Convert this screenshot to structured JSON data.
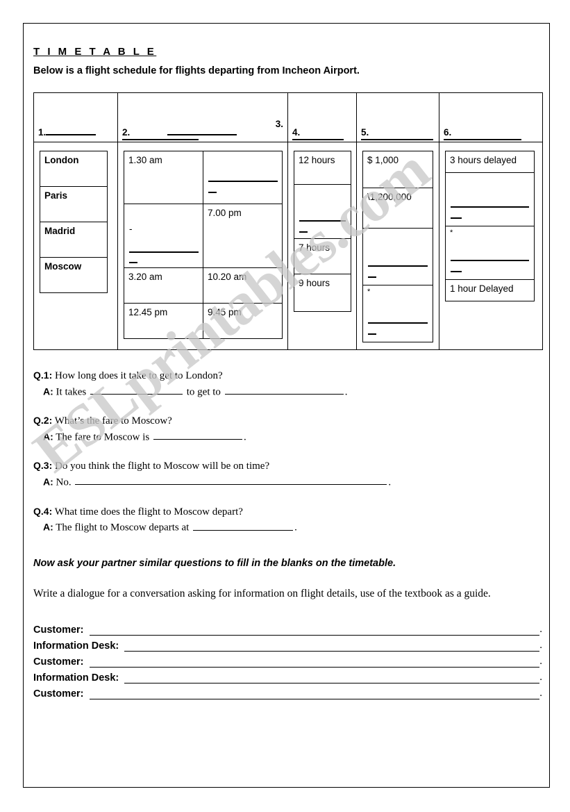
{
  "document": {
    "title": "T I M E T A B L E",
    "subtitle": "Below is a flight schedule for flights departing from Incheon Airport.",
    "watermark": "ESLprintables.com"
  },
  "timetable": {
    "headers": [
      {
        "num": "1.",
        "blank_after": true
      },
      {
        "num": "2.",
        "blank_after": true,
        "extra_num": "3."
      },
      {
        "num": "4.",
        "blank_after": true
      },
      {
        "num": "5.",
        "blank_after": true
      },
      {
        "num": "6.",
        "blank_after": true
      }
    ],
    "destinations": [
      "London",
      "Paris",
      "Madrid",
      "Moscow"
    ],
    "departures": [
      "1.30 am",
      "",
      "3.20 am",
      "12.45 pm"
    ],
    "arrivals": [
      "",
      "7.00 pm",
      "10.20 am",
      "9.45 pm"
    ],
    "durations": [
      "12 hours",
      "",
      "7 hours",
      "9 hours"
    ],
    "fares": [
      "$ 1,000",
      "\\1,200,000",
      "",
      ""
    ],
    "status": [
      "3 hours delayed",
      "",
      "",
      "1 hour Delayed"
    ]
  },
  "questions": [
    {
      "q_label": "Q.1:",
      "q_text": "How long does it take to get to London?",
      "a_label": "A:",
      "a_prefix": "It takes",
      "a_middle": "to get to",
      "a_suffix": "."
    },
    {
      "q_label": "Q.2:",
      "q_text": "What’s the fare to Moscow?",
      "a_label": "A:",
      "a_prefix": "The fare to Moscow is",
      "a_middle": "",
      "a_suffix": "."
    },
    {
      "q_label": "Q.3:",
      "q_text": "Do you think the flight to Moscow will be on time?",
      "a_label": "A:",
      "a_prefix": "No.",
      "a_middle": "",
      "a_suffix": "."
    },
    {
      "q_label": "Q.4:",
      "q_text": "What time does the flight to Moscow depart?",
      "a_label": "A:",
      "a_prefix": "The flight to Moscow departs at",
      "a_middle": "",
      "a_suffix": "."
    }
  ],
  "instructions": {
    "partner_task": "Now ask your partner similar questions to fill in the blanks on the timetable.",
    "writing_task": "Write a dialogue for a conversation asking for information on flight details, use of the textbook as a guide."
  },
  "dialogue": {
    "rows": [
      {
        "speaker": "Customer:",
        "end": "."
      },
      {
        "speaker": "Information Desk:",
        "end": "."
      },
      {
        "speaker": "Customer:",
        "end": "."
      },
      {
        "speaker": "Information Desk:",
        "end": "."
      },
      {
        "speaker": "Customer:",
        "end": "."
      }
    ]
  }
}
